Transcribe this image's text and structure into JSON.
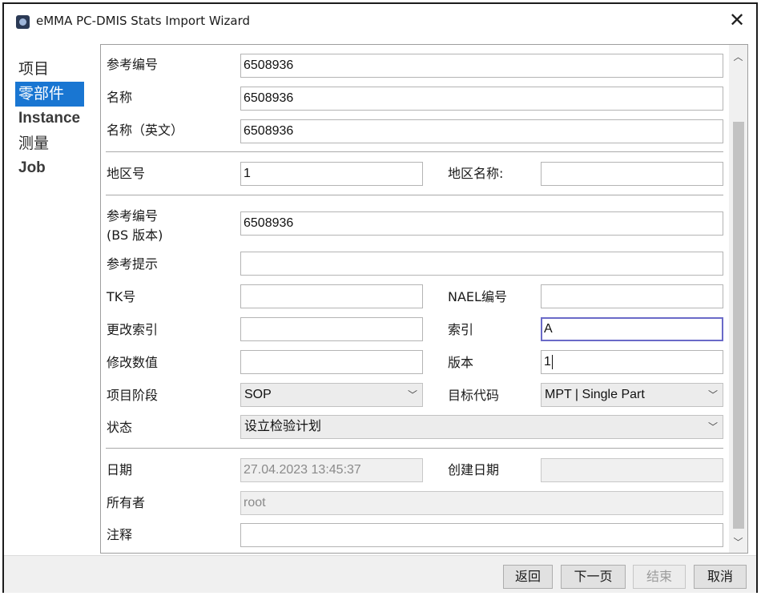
{
  "window": {
    "title": "eMMA PC-DMIS Stats Import Wizard",
    "close_glyph": "✕"
  },
  "nav": {
    "items": [
      {
        "label": "项目"
      },
      {
        "label": "零部件"
      },
      {
        "label": "Instance"
      },
      {
        "label": "测量"
      },
      {
        "label": "Job"
      }
    ],
    "active_color": "#1976d2"
  },
  "form": {
    "ref_number": {
      "label": "参考编号",
      "value": "6508936"
    },
    "name": {
      "label": "名称",
      "value": "6508936"
    },
    "name_en": {
      "label": "名称（英文）",
      "value": "6508936"
    },
    "region_no": {
      "label": "地区号",
      "value": "1"
    },
    "region_name": {
      "label": "地区名称:",
      "value": ""
    },
    "ref_number_bs": {
      "label_line1": "参考编号",
      "label_line2": "(BS 版本)",
      "value": "6508936"
    },
    "ref_hint": {
      "label": "参考提示",
      "value": ""
    },
    "tk_no": {
      "label": "TK号",
      "value": ""
    },
    "nael_no": {
      "label": "NAEL编号",
      "value": ""
    },
    "change_index": {
      "label": "更改索引",
      "value": ""
    },
    "index": {
      "label": "索引",
      "value": "A"
    },
    "mod_value": {
      "label": "修改数值",
      "value": ""
    },
    "version": {
      "label": "版本",
      "value": "1"
    },
    "project_phase": {
      "label": "项目阶段",
      "value": "SOP"
    },
    "target_code": {
      "label": "目标代码",
      "value": "MPT | Single Part"
    },
    "status": {
      "label": "状态",
      "value": "设立检验计划"
    },
    "date": {
      "label": "日期",
      "value": "27.04.2023 13:45:37"
    },
    "created_date": {
      "label": "创建日期",
      "value": ""
    },
    "owner": {
      "label": "所有者",
      "value": "root"
    },
    "comment": {
      "label": "注释",
      "value": ""
    }
  },
  "footer": {
    "back_label": "返回",
    "next_label": "下一页",
    "finish_label": "结束",
    "cancel_label": "取消"
  },
  "icons": {
    "chevron_down": "﹀",
    "scroll_up": "︿",
    "scroll_down": "﹀"
  }
}
